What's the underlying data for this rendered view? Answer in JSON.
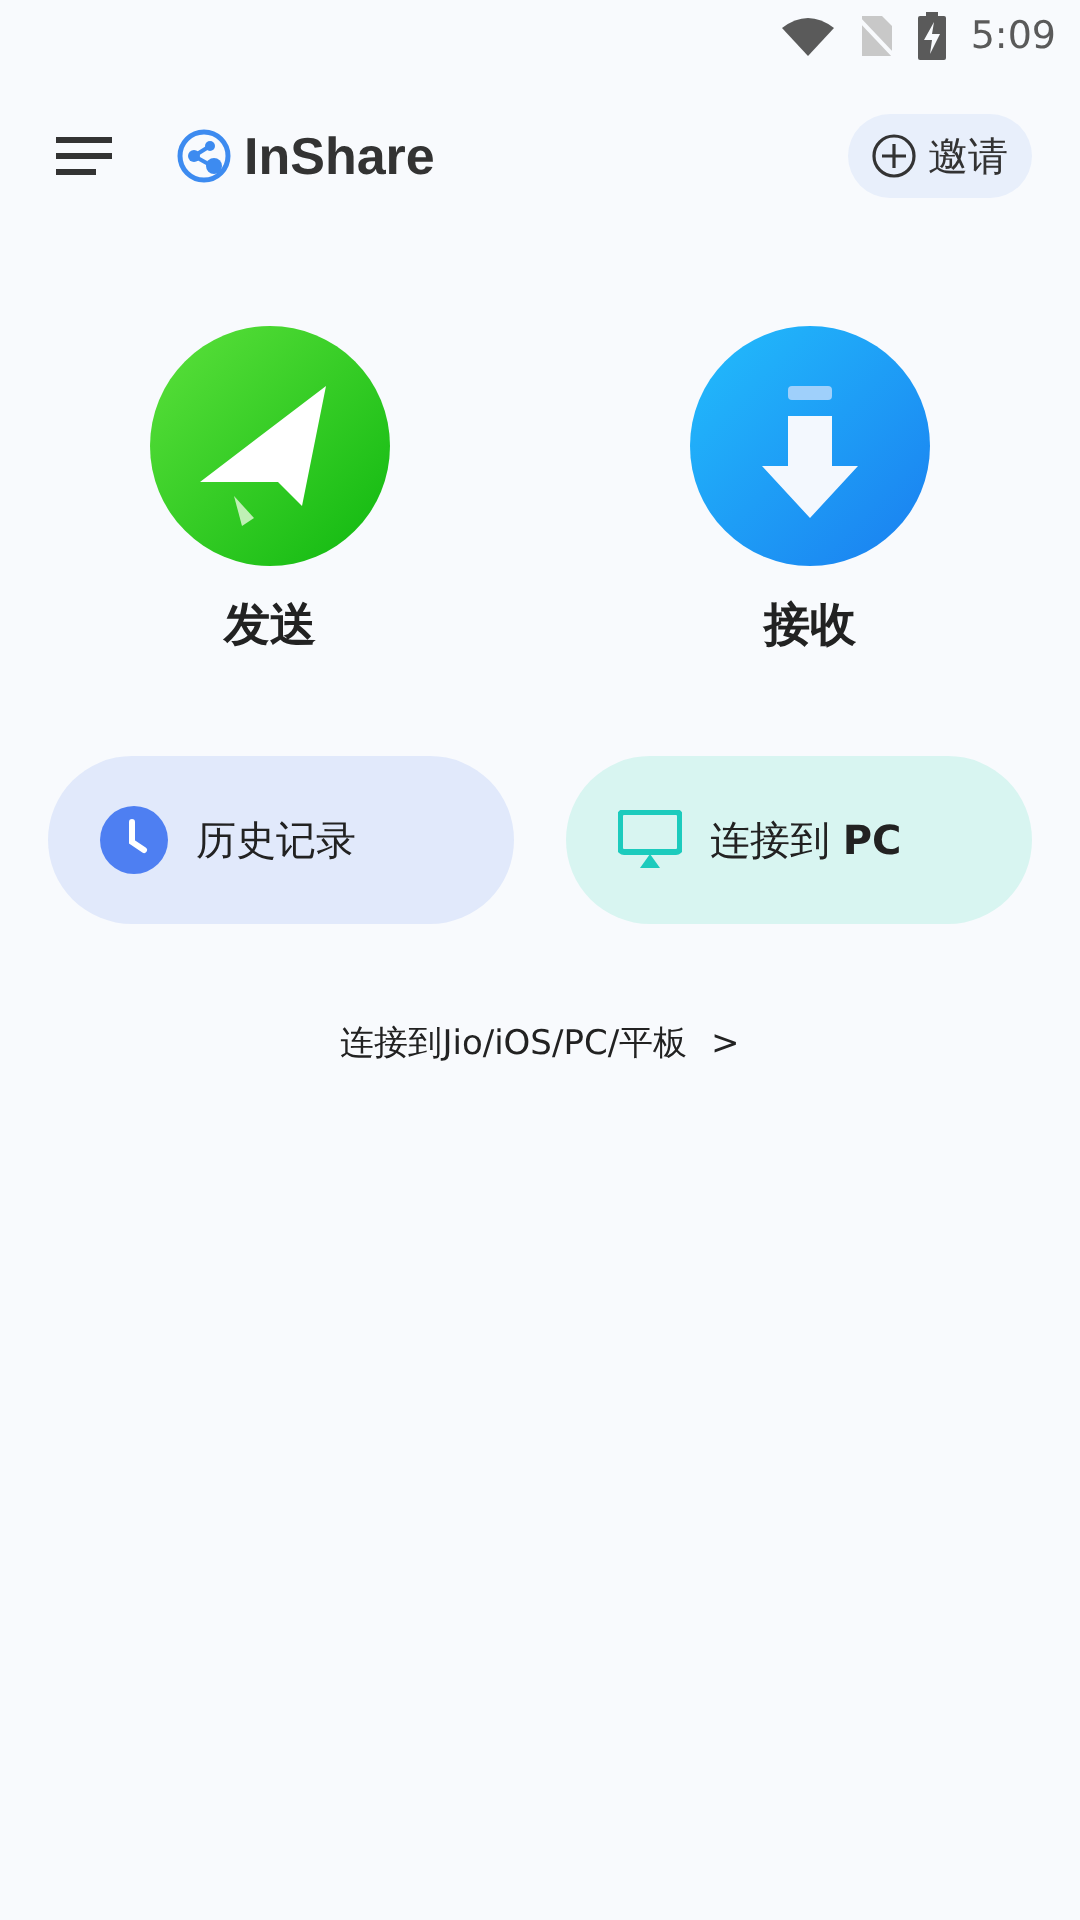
{
  "status_bar": {
    "time": "5:09"
  },
  "header": {
    "app_name": "InShare",
    "invite_button": "邀请"
  },
  "actions": [
    {
      "kind": "send",
      "label": "发送"
    },
    {
      "kind": "receive",
      "label": "接收"
    }
  ],
  "shortcuts": [
    {
      "kind": "history",
      "label": "历史记录"
    },
    {
      "kind": "pc",
      "label": "连接到 **PC**"
    }
  ],
  "link": {
    "label": "连接到Jio/iOS/PC/平板",
    "arrow": ">"
  }
}
